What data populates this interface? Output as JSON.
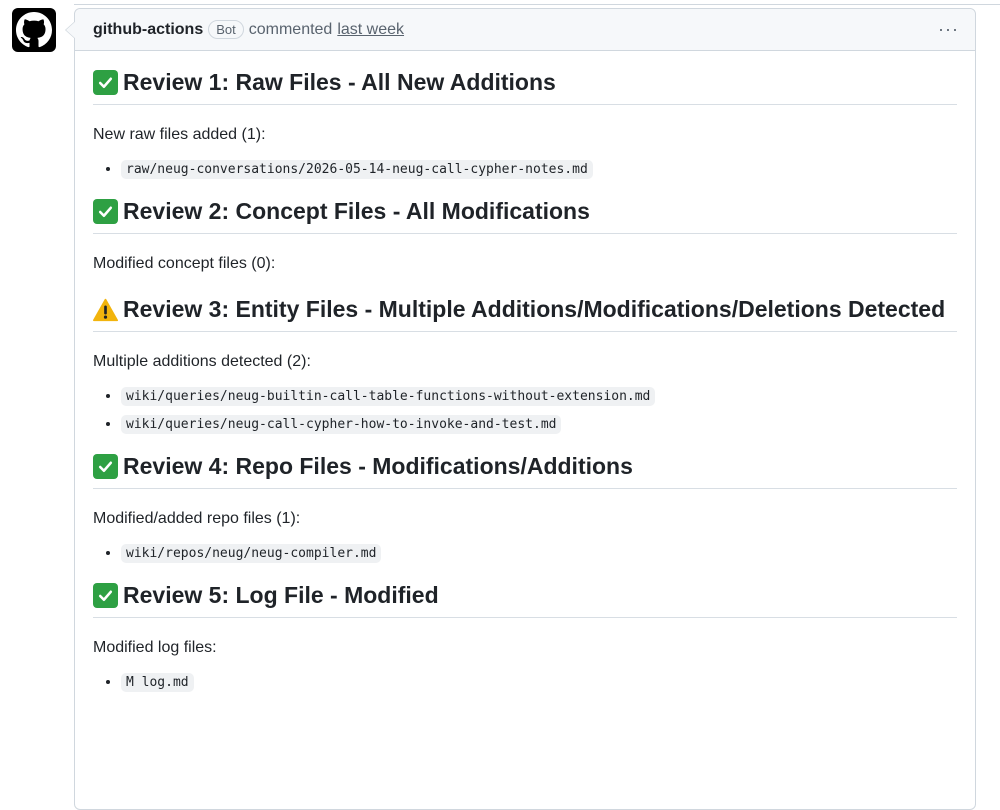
{
  "comment": {
    "author": "github-actions",
    "badge": "Bot",
    "action": "commented",
    "timestamp": "last week",
    "more_label": "···"
  },
  "reviews": [
    {
      "status": "check",
      "title": "Review 1: Raw Files - All New Additions",
      "intro": "New raw files added (1):",
      "files": [
        "raw/neug-conversations/2026-05-14-neug-call-cypher-notes.md"
      ]
    },
    {
      "status": "check",
      "title": "Review 2: Concept Files - All Modifications",
      "intro": "Modified concept files (0):",
      "files": []
    },
    {
      "status": "warning",
      "title": "Review 3: Entity Files - Multiple Additions/Modifications/Deletions Detected",
      "intro": "Multiple additions detected (2):",
      "files": [
        "wiki/queries/neug-builtin-call-table-functions-without-extension.md",
        "wiki/queries/neug-call-cypher-how-to-invoke-and-test.md"
      ]
    },
    {
      "status": "check",
      "title": "Review 4: Repo Files - Modifications/Additions",
      "intro": "Modified/added repo files (1):",
      "files": [
        "wiki/repos/neug/neug-compiler.md"
      ]
    },
    {
      "status": "check",
      "title": "Review 5: Log File - Modified",
      "intro": "Modified log files:",
      "files": [
        "M log.md"
      ]
    }
  ],
  "colors": {
    "check": "#2ea043",
    "warning": "#f2b40d",
    "border": "#d0d7de",
    "header_bg": "#f6f8fa"
  },
  "icons": {
    "avatar": "github-mark-icon",
    "check": "check-mark-button-icon",
    "warning": "warning-icon"
  }
}
